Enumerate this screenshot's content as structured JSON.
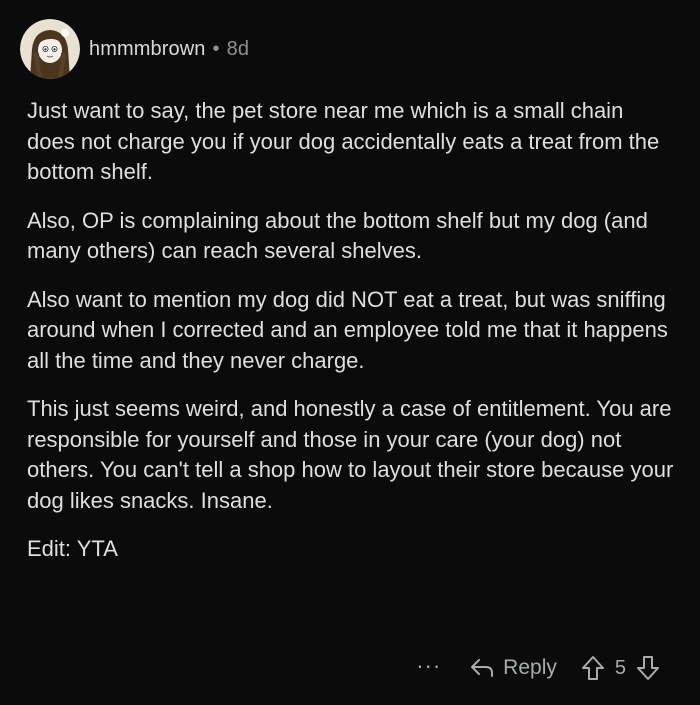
{
  "comment": {
    "username": "hmmmbrown",
    "separator": "•",
    "age": "8d",
    "paragraphs": [
      "Just want to say, the pet store near me which is a small chain does not charge you if your dog accidentally eats a treat from the bottom shelf.",
      "Also, OP is complaining about the bottom shelf but my dog (and many others) can reach several shelves.",
      "Also want to mention my dog did NOT eat a treat, but was sniffing around when I corrected and an employee told me that it happens all the time and they never charge.",
      "This just seems weird, and honestly a case of entitlement. You are responsible for yourself and those in your care (your dog) not others. You can't tell a shop how to layout their store because your dog likes snacks. Insane.",
      "Edit: YTA"
    ]
  },
  "actions": {
    "more_label": "···",
    "reply_label": "Reply",
    "vote_count": "5",
    "icons": {
      "more": "more-options-icon",
      "reply": "reply-arrow-icon",
      "upvote": "upvote-icon",
      "downvote": "downvote-icon"
    }
  },
  "colors": {
    "background": "#0b0b0b",
    "text": "#dddfe0",
    "muted": "#8e9294"
  }
}
